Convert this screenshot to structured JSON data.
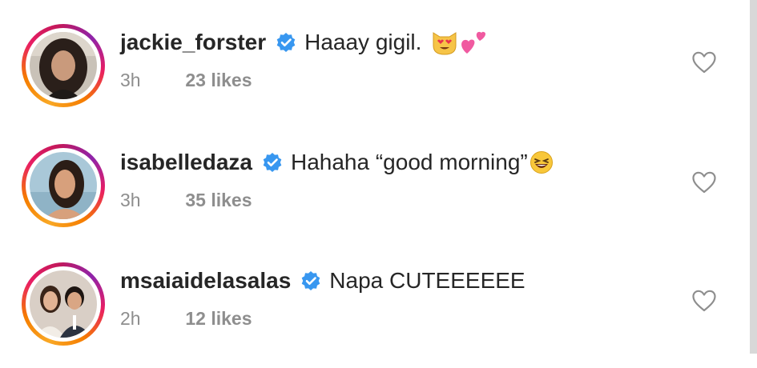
{
  "comments": [
    {
      "username": "jackie_forster",
      "verified": true,
      "text": "Haaay gigil.",
      "emojis": [
        "heart-eyes-cat-emoji",
        "two-hearts-emoji"
      ],
      "time": "3h",
      "likes": "23 likes",
      "avatar": "profile-photo-jackie"
    },
    {
      "username": "isabelledaza",
      "verified": true,
      "text": "Hahaha “good morning”",
      "emojis": [
        "laughing-emoji"
      ],
      "time": "3h",
      "likes": "35 likes",
      "avatar": "profile-photo-isabelle"
    },
    {
      "username": "msaiaidelasalas",
      "verified": true,
      "text": "Napa CUTEEEEEE",
      "emojis": [],
      "time": "2h",
      "likes": "12 likes",
      "avatar": "profile-photo-couple"
    }
  ],
  "icons": {
    "verified": "verified-badge-icon",
    "like": "heart-outline-icon"
  },
  "colors": {
    "verified_blue": "#3897f0",
    "username": "#262626",
    "meta": "#8e8e8e"
  }
}
